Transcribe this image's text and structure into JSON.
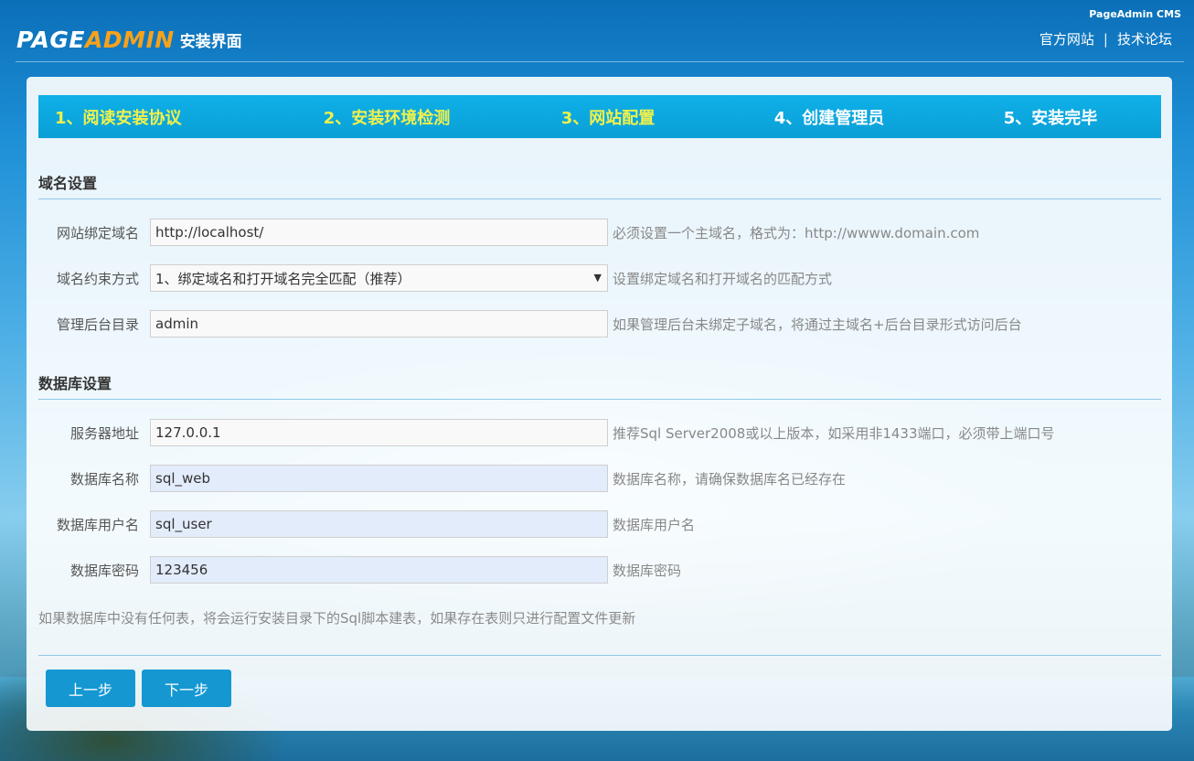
{
  "brand": {
    "corner_text": "PageAdmin CMS",
    "logo_page": "PAGE",
    "logo_admin": "ADMIN",
    "logo_sub": "安装界面"
  },
  "top_links": {
    "official_site": "官方网站",
    "separator": "|",
    "forum": "技术论坛"
  },
  "steps": [
    {
      "label": "1、阅读安装协议",
      "state": "done"
    },
    {
      "label": "2、安装环境检测",
      "state": "done"
    },
    {
      "label": "3、网站配置",
      "state": "current"
    },
    {
      "label": "4、创建管理员",
      "state": "pending"
    },
    {
      "label": "5、安装完毕",
      "state": "pending"
    }
  ],
  "domain_section": {
    "title": "域名设置",
    "fields": [
      {
        "label": "网站绑定域名",
        "value": "http://localhost/",
        "hint": "必须设置一个主域名，格式为：http://wwww.domain.com"
      },
      {
        "label": "域名约束方式",
        "value": "1、绑定域名和打开域名完全匹配（推荐）",
        "hint": "设置绑定域名和打开域名的匹配方式"
      },
      {
        "label": "管理后台目录",
        "value": "admin",
        "hint": "如果管理后台未绑定子域名，将通过主域名+后台目录形式访问后台"
      }
    ]
  },
  "db_section": {
    "title": "数据库设置",
    "fields": [
      {
        "label": "服务器地址",
        "value": "127.0.0.1",
        "hint": "推荐Sql Server2008或以上版本，如采用非1433端口，必须带上端口号"
      },
      {
        "label": "数据库名称",
        "value": "sql_web",
        "hint": "数据库名称，请确保数据库名已经存在"
      },
      {
        "label": "数据库用户名",
        "value": "sql_user",
        "hint": "数据库用户名"
      },
      {
        "label": "数据库密码",
        "value": "123456",
        "hint": "数据库密码"
      }
    ]
  },
  "note": "如果数据库中没有任何表，将会运行安装目录下的Sql脚本建表，如果存在表则只进行配置文件更新",
  "buttons": {
    "prev": "上一步",
    "next": "下一步"
  },
  "colors": {
    "step_bar": "#0fb0e8",
    "step_done_text": "#f0f14a",
    "button": "#1598d2",
    "logo_accent": "#f7a21b"
  }
}
